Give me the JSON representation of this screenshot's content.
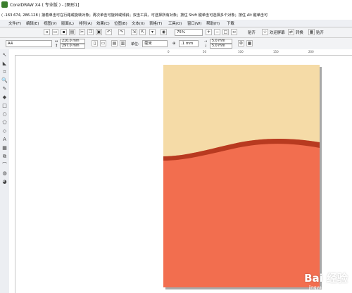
{
  "window": {
    "title": "CorelDRAW X4 ( 专业版 ) - [图形1]"
  },
  "status": {
    "text": "( -163.674, 286.128 )  接着单击可在行路或旋转对象；再次单击可旋转或倾斜；双击工具，可选择所有对象；按住 Shift 键单击可选择多个对象；按住 Alt 键单击可"
  },
  "menu": [
    "文件(F)",
    "编辑(E)",
    "视图(V)",
    "版面(L)",
    "排列(A)",
    "效果(C)",
    "位图(B)",
    "文本(X)",
    "表格(T)",
    "工具(O)",
    "窗口(W)",
    "帮助(H)",
    "下载"
  ],
  "toolbar": {
    "zoom": "75%",
    "snap_label": "贴齐",
    "welcome_label": "欢迎屏幕",
    "convert_label": "转换",
    "paste_label": "贴齐"
  },
  "property_bar": {
    "page_size": "A4",
    "width": "210.0 mm",
    "height": "297.0 mm",
    "units_label": "单位:",
    "units": "毫米",
    "nudge": ".1 mm",
    "dup_x": "5.0 mm",
    "dup_y": "5.0 mm"
  },
  "rulers": {
    "top": [
      "0",
      "50",
      "100",
      "150",
      "200"
    ]
  },
  "watermark": {
    "logo": "Bai 经验",
    "url": "jingyan.baidu.com"
  },
  "colors": {
    "page_top": "#f5dba7",
    "page_bottom": "#f26e4f",
    "wave_stroke": "#b83a20"
  },
  "icons": [
    "new-icon",
    "open-icon",
    "save-icon",
    "print-icon",
    "cut-icon",
    "copy-icon",
    "paste-icon",
    "undo-icon",
    "redo-icon",
    "import-icon",
    "export-icon",
    "zoom-icon",
    "pick-tool-icon",
    "shape-tool-icon",
    "crop-tool-icon",
    "zoom-tool-icon",
    "freehand-tool-icon",
    "smart-fill-icon",
    "rectangle-tool-icon",
    "ellipse-tool-icon",
    "polygon-tool-icon",
    "text-tool-icon",
    "interactive-tool-icon",
    "eyedropper-icon",
    "outline-icon",
    "fill-icon"
  ]
}
